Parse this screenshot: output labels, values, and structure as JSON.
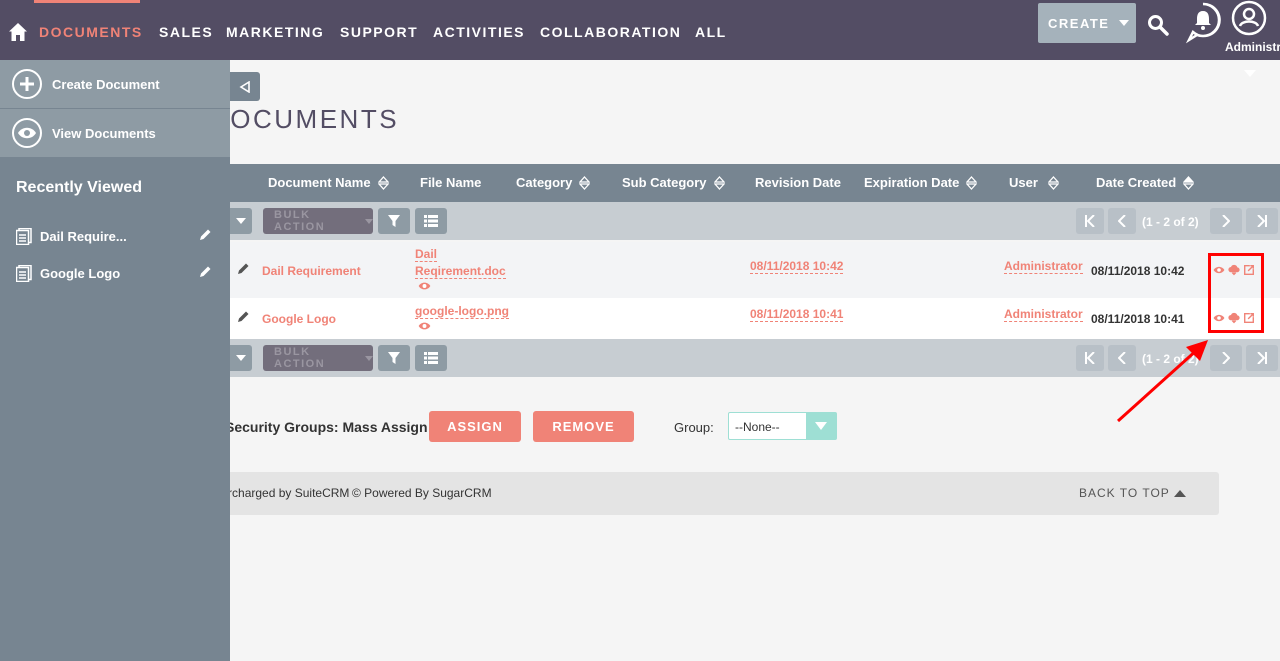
{
  "nav": {
    "tabs": [
      "DOCUMENTS",
      "SALES",
      "MARKETING",
      "SUPPORT",
      "ACTIVITIES",
      "COLLABORATION",
      "ALL"
    ],
    "create_label": "CREATE",
    "user_label": "Administrator"
  },
  "sidebar": {
    "actions": [
      "Create Document",
      "View Documents"
    ],
    "recent_title": "Recently Viewed",
    "recent_items": [
      "Dail Require...",
      "Google Logo"
    ]
  },
  "page": {
    "title": "DOCUMENTS"
  },
  "table": {
    "columns": [
      "Document Name",
      "File Name",
      "Category",
      "Sub Category",
      "Revision Date",
      "Expiration Date",
      "User",
      "Date Created"
    ],
    "bulk_action_label": "BULK ACTION",
    "pagination_text": "(1 - 2 of 2)",
    "rows": [
      {
        "name": "Dail Requirement",
        "file_line1": "Dail",
        "file_line2": "Reqirement.doc",
        "revision_date": "08/11/2018 10:42",
        "user": "Administrator",
        "date_created": "08/11/2018 10:42"
      },
      {
        "name": "Google Logo",
        "file_line1": "google-logo.png",
        "revision_date": "08/11/2018 10:41",
        "user": "Administrator",
        "date_created": "08/11/2018 10:41"
      }
    ]
  },
  "security_groups": {
    "label": "Security Groups: Mass Assign",
    "assign_label": "ASSIGN",
    "remove_label": "REMOVE",
    "group_label": "Group:",
    "group_value": "--None--"
  },
  "footer": {
    "supercharged": "Supercharged by SuiteCRM",
    "powered": "© Powered By SugarCRM",
    "back_to_top": "BACK TO TOP"
  },
  "colors": {
    "nav_bg": "#534d64",
    "accent": "#f08377",
    "sidebar_bg": "#778591",
    "annotation": "#ff0000"
  }
}
